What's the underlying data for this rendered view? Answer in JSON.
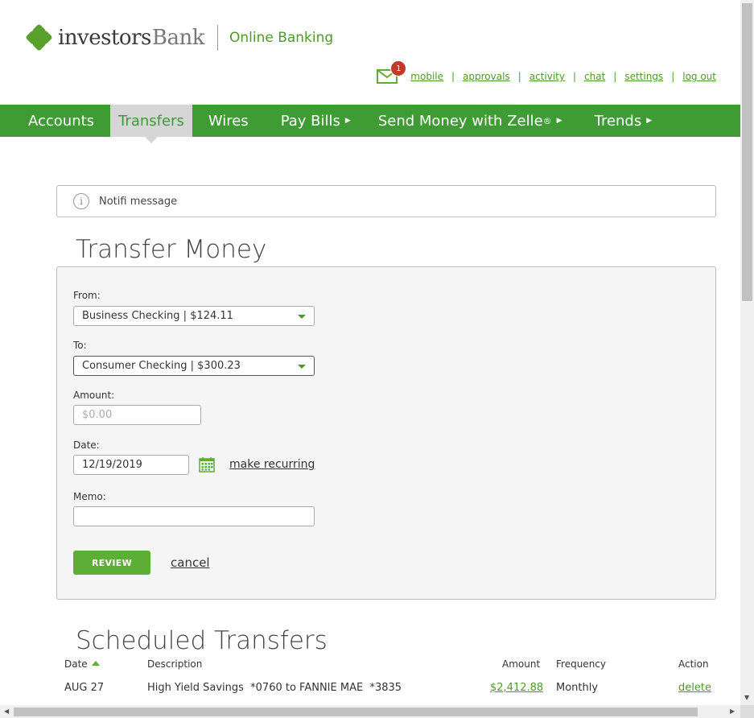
{
  "brand": {
    "name_part1": "investors",
    "name_part2": "Bank",
    "subtitle": "Online Banking",
    "accent": "#3f9b34"
  },
  "toplinks": {
    "mail_badge": "1",
    "items": [
      "mobile",
      "approvals",
      "activity",
      "chat",
      "settings",
      "log out"
    ]
  },
  "nav": {
    "items": [
      {
        "label": "Accounts"
      },
      {
        "label": "Transfers",
        "active": true
      },
      {
        "label": "Wires"
      },
      {
        "label": "Pay Bills"
      },
      {
        "label": "Send Money with Zelle",
        "sup": "®"
      },
      {
        "label": "Trends"
      }
    ]
  },
  "notification": {
    "text": "Notifi message",
    "icon": "info-icon"
  },
  "transfer": {
    "title": "Transfer Money",
    "from_label": "From:",
    "from_value": "Business Checking | $124.11",
    "to_label": "To:",
    "to_value": "Consumer Checking | $300.23",
    "amount_label": "Amount:",
    "amount_placeholder": "$0.00",
    "date_label": "Date:",
    "date_value": "12/19/2019",
    "recurring_link": "make recurring",
    "memo_label": "Memo:",
    "memo_value": "",
    "review_button": "REVIEW",
    "cancel_link": "cancel"
  },
  "scheduled": {
    "title": "Scheduled Transfers",
    "columns": [
      "Date",
      "Description",
      "Amount",
      "Frequency",
      "Action"
    ],
    "rows": [
      {
        "date": "AUG 27",
        "description": "High Yield Savings  *0760 to FANNIE MAE  *3835",
        "amount": "$2,412.88",
        "frequency": "Monthly",
        "action": "delete"
      }
    ]
  }
}
